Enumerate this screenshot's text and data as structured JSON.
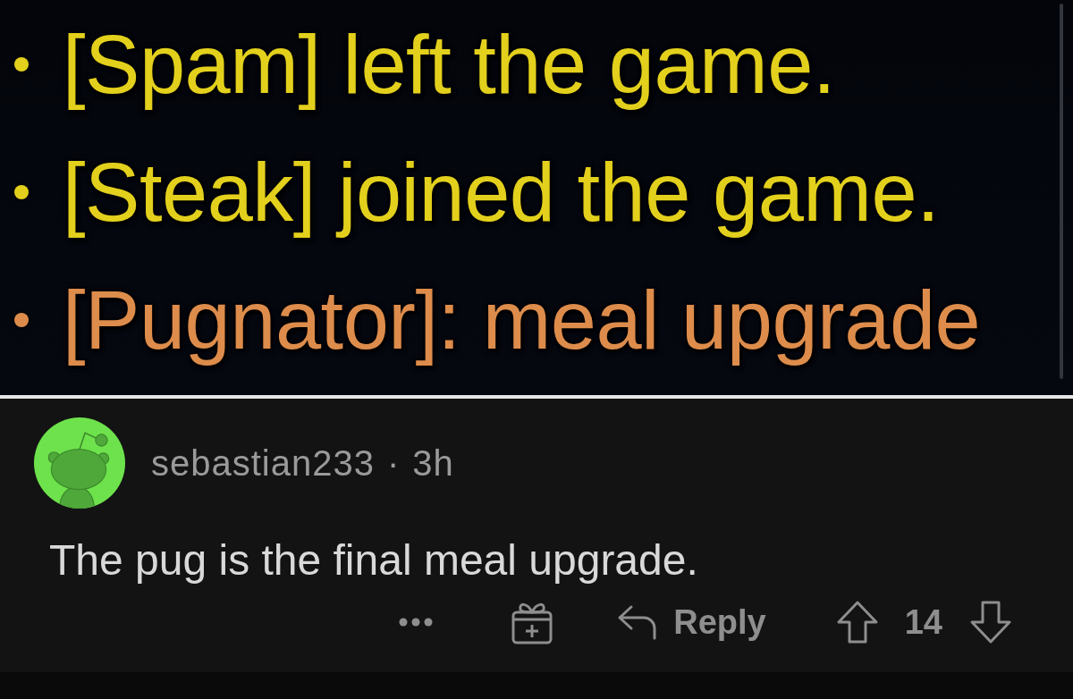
{
  "chat": {
    "messages": [
      {
        "kind": "system",
        "text": "[Spam] left the game."
      },
      {
        "kind": "system",
        "text": "[Steak] joined the game."
      },
      {
        "kind": "player",
        "text": "[Pugnator]: meal upgrade"
      }
    ]
  },
  "comment": {
    "author": "sebastian233",
    "separator": "·",
    "age": "3h",
    "body": "The pug is the final meal upgrade.",
    "actions": {
      "reply": "Reply",
      "score": "14"
    }
  }
}
